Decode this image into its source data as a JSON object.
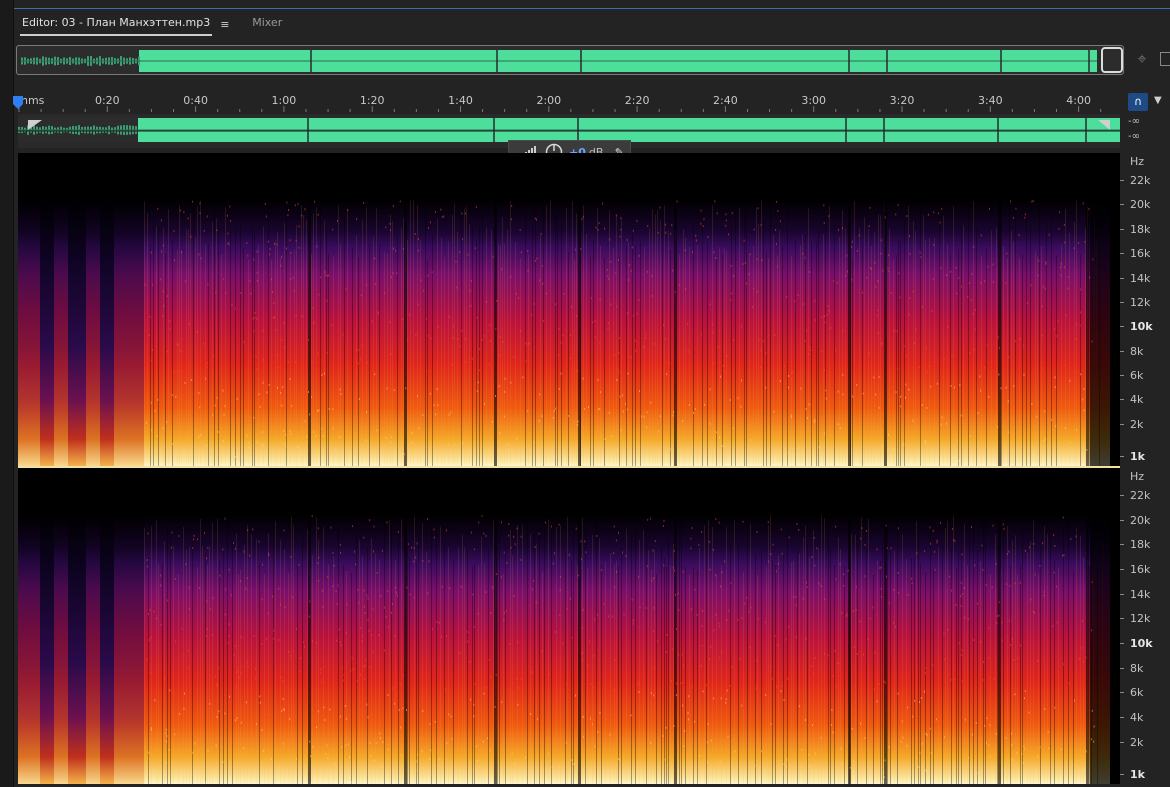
{
  "tabs": {
    "editor_label": "Editor: 03 - План Манхэттен.mp3",
    "mixer_label": "Mixer"
  },
  "timeline": {
    "ticks": [
      "hms",
      "0:20",
      "0:40",
      "1:00",
      "1:20",
      "1:40",
      "2:00",
      "2:20",
      "2:40",
      "3:00",
      "3:20",
      "3:40",
      "4:00"
    ]
  },
  "meter": {
    "ch1": "-∞",
    "ch2": "-∞"
  },
  "hud": {
    "value": "+0",
    "unit": "dB"
  },
  "spectral": {
    "unit": "Hz",
    "labels": [
      "22k",
      "20k",
      "18k",
      "16k",
      "14k",
      "12k",
      "10k",
      "8k",
      "6k",
      "4k",
      "2k",
      "1k"
    ]
  },
  "colors": {
    "waveform": "#4ede9c",
    "accent": "#3a6fb7",
    "hud_value": "#66a6ff"
  },
  "icons": {
    "zoom": "zoom-to-selection-icon",
    "snap": "magnet-icon",
    "pin": "pin-icon",
    "playhead": "playhead-icon",
    "menu": "hamburger-menu-icon",
    "meter": "signal-meter-icon",
    "knob": "volume-knob-icon"
  }
}
